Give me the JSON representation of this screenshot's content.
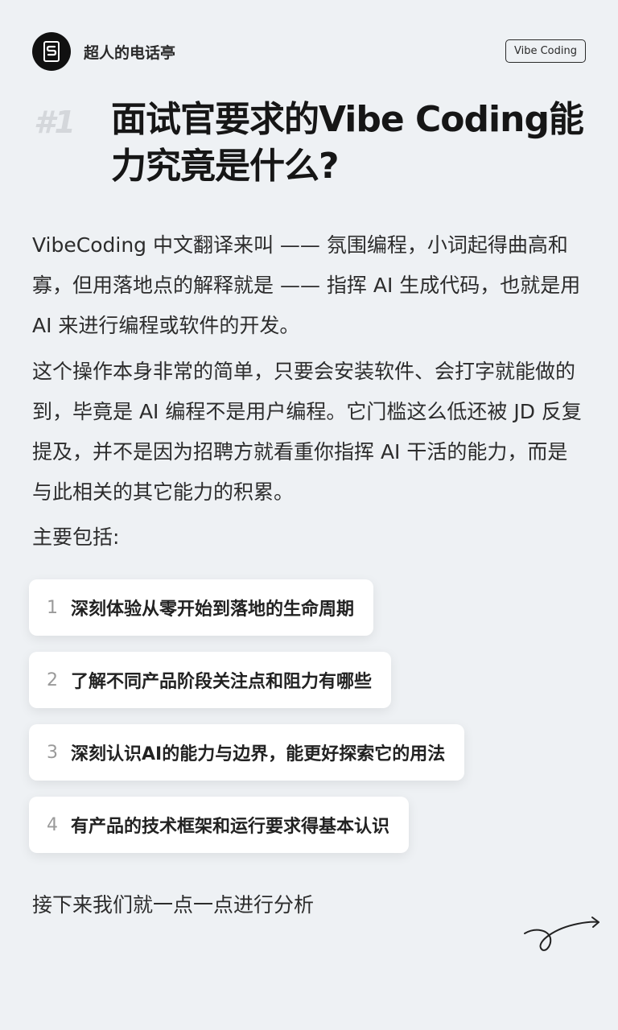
{
  "header": {
    "account_name": "超人的电话亭",
    "tag": "Vibe Coding"
  },
  "title": {
    "number": "#1",
    "text": "面试官要求的Vibe Coding能力究竟是什么?"
  },
  "paragraphs": [
    "VibeCoding 中文翻译来叫 —— 氛围编程，小词起得曲高和寡，但用落地点的解释就是 —— 指挥 AI 生成代码，也就是用 AI 来进行编程或软件的开发。",
    "这个操作本身非常的简单，只要会安装软件、会打字就能做的到，毕竟是 AI 编程不是用户编程。它门槛这么低还被 JD 反复提及，并不是因为招聘方就看重你指挥 AI 干活的能力，而是与此相关的其它能力的积累。",
    "主要包括:"
  ],
  "items": [
    {
      "num": "1",
      "text": "深刻体验从零开始到落地的生命周期"
    },
    {
      "num": "2",
      "text": "了解不同产品阶段关注点和阻力有哪些"
    },
    {
      "num": "3",
      "text": "深刻认识AI的能力与边界，能更好探索它的用法"
    },
    {
      "num": "4",
      "text": "有产品的技术框架和运行要求得基本认识"
    }
  ],
  "footer_text": "接下来我们就一点一点进行分析",
  "colors": {
    "background": "#eef1f4",
    "card": "#ffffff",
    "text": "#1f1f1f",
    "muted_number": "#d4d7db"
  }
}
